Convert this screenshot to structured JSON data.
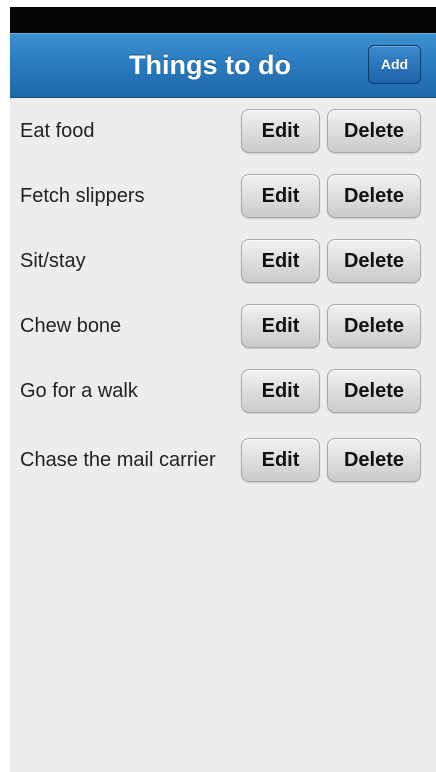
{
  "header": {
    "title": "Things to do",
    "add_label": "Add"
  },
  "todos": [
    {
      "label": "Eat food",
      "edit_label": "Edit",
      "delete_label": "Delete"
    },
    {
      "label": "Fetch slippers",
      "edit_label": "Edit",
      "delete_label": "Delete"
    },
    {
      "label": "Sit/stay",
      "edit_label": "Edit",
      "delete_label": "Delete"
    },
    {
      "label": "Chew bone",
      "edit_label": "Edit",
      "delete_label": "Delete"
    },
    {
      "label": "Go for a walk",
      "edit_label": "Edit",
      "delete_label": "Delete"
    },
    {
      "label": "Chase the mail carrier",
      "edit_label": "Edit",
      "delete_label": "Delete"
    }
  ],
  "colors": {
    "nav_bar": "#2a7bc0",
    "status_bar": "#050505",
    "background": "#ededed"
  }
}
